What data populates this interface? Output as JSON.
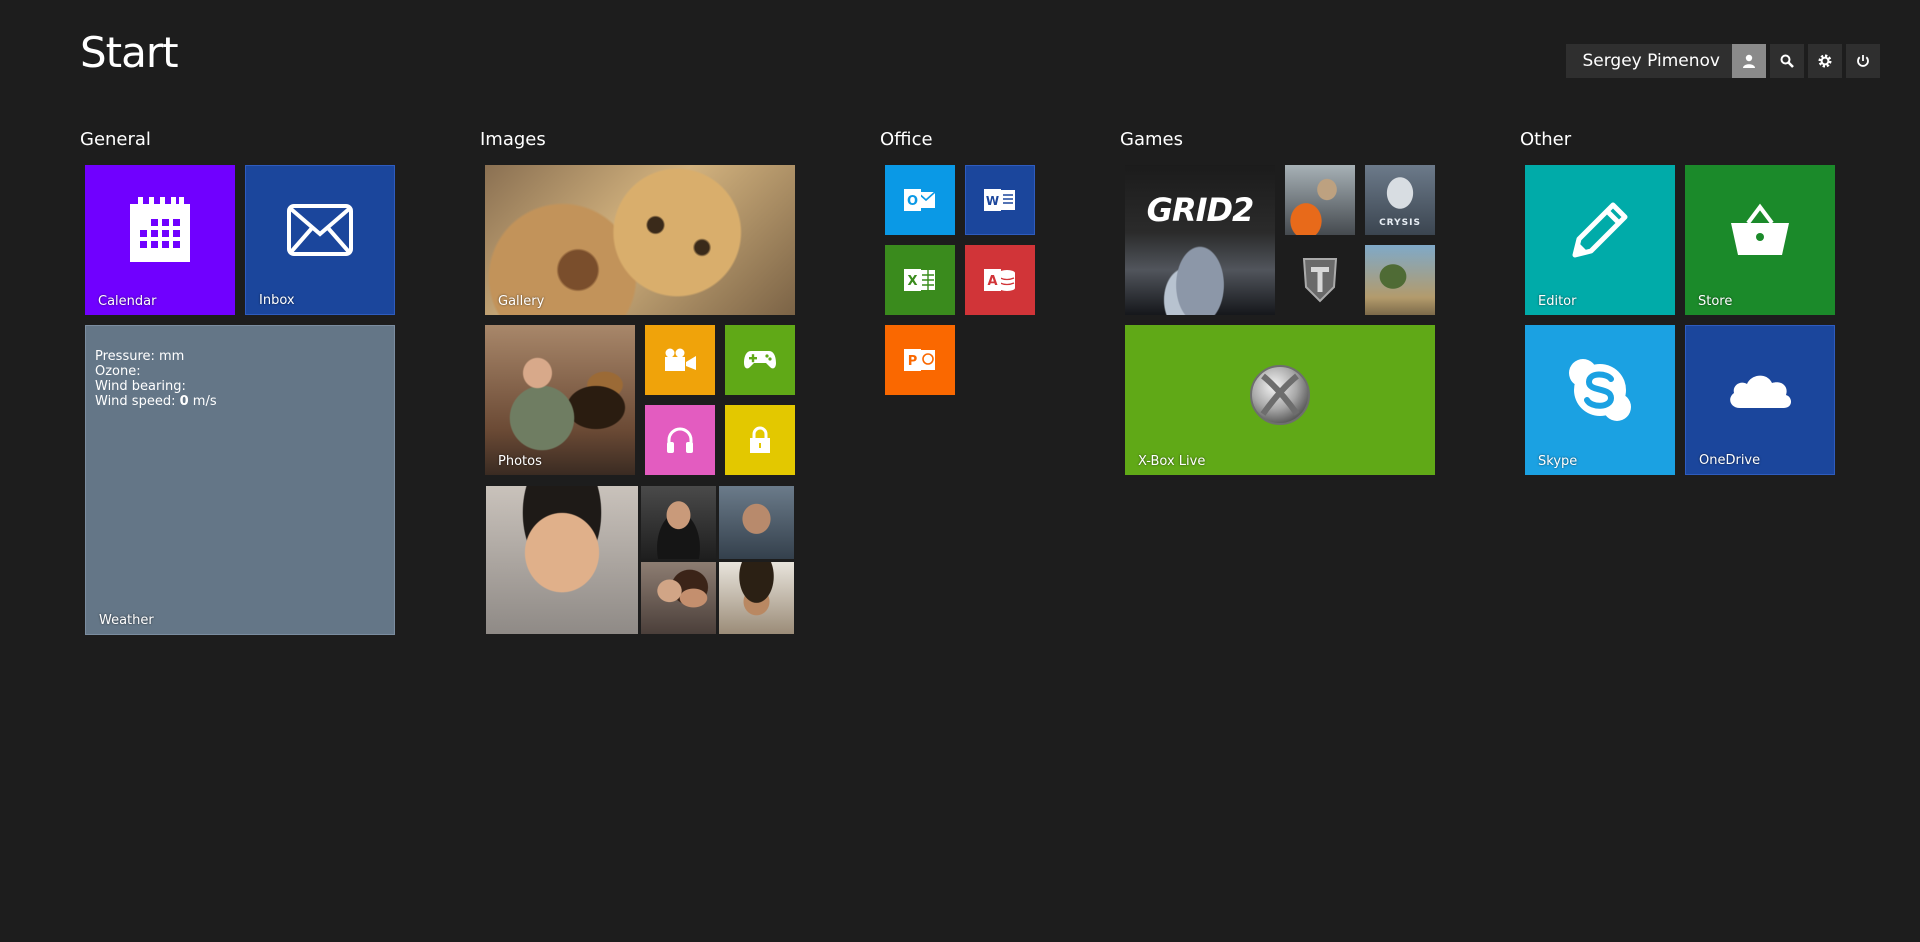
{
  "header": {
    "title": "Start",
    "user_name": "Sergey Pimenov"
  },
  "groups": {
    "general": {
      "title": "General",
      "calendar_label": "Calendar",
      "inbox_label": "Inbox",
      "weather": {
        "label": "Weather",
        "pressure": "Pressure: mm",
        "ozone": "Ozone:",
        "wind_bearing": "Wind bearing:",
        "wind_speed_prefix": "Wind speed:",
        "wind_speed_value": "0",
        "wind_speed_unit": "m/s"
      }
    },
    "images": {
      "title": "Images",
      "gallery_label": "Gallery",
      "photos_label": "Photos"
    },
    "office": {
      "title": "Office",
      "outlook_letter": "O",
      "word_letter": "W",
      "excel_letter": "X",
      "access_letter": "A",
      "powerpoint_letter": "P"
    },
    "games": {
      "title": "Games",
      "grid_text": "GRID2",
      "crysis_text": "CRYSIS",
      "xbox_label": "X-Box Live"
    },
    "other": {
      "title": "Other",
      "editor_label": "Editor",
      "store_label": "Store",
      "skype_label": "Skype",
      "onedrive_label": "OneDrive"
    }
  },
  "colors": {
    "background": "#1d1d1d",
    "calendar": "#7000ff",
    "inbox": "#1b469c",
    "weather": "#647687",
    "video": "#f0a30a",
    "gamepad": "#60a917",
    "music": "#e35cc0",
    "lock": "#e3c800",
    "outlook": "#0a99e6",
    "word": "#1b469c",
    "excel": "#3a8b1d",
    "access": "#d13438",
    "powerpoint": "#fa6800",
    "xbox": "#60a917",
    "editor": "#00aba9",
    "store": "#1b8a2a",
    "skype": "#1ba1e2",
    "onedrive": "#1b469c"
  }
}
